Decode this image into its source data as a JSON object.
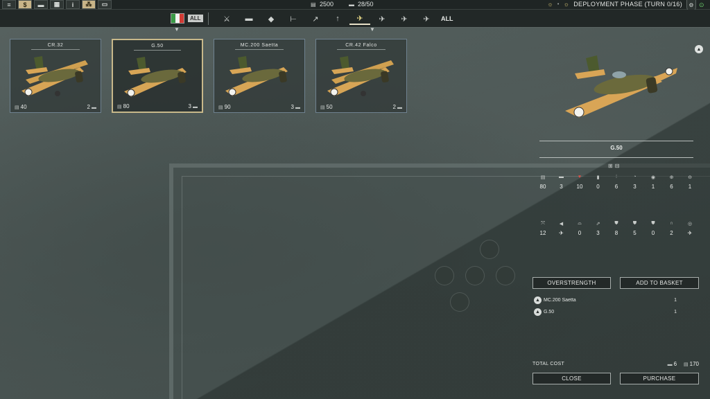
{
  "topbar": {
    "buttons": [
      {
        "icon": "menu-icon",
        "glyph": "≡"
      },
      {
        "icon": "money-icon",
        "glyph": "$"
      },
      {
        "icon": "chat-icon",
        "glyph": "▬"
      },
      {
        "icon": "grid-icon",
        "glyph": "▦"
      },
      {
        "icon": "info-icon",
        "glyph": "i"
      },
      {
        "icon": "unit-icon",
        "glyph": "⁂"
      },
      {
        "icon": "screen-icon",
        "glyph": "▭"
      }
    ],
    "prestige": "2500",
    "unit_slots": "28/50",
    "phase": "DEPLOYMENT PHASE (TURN 0/16)"
  },
  "filterbar": {
    "all_chip": "ALL",
    "categories": [
      {
        "name": "infantry",
        "glyph": "⚔"
      },
      {
        "name": "tank",
        "glyph": "▬"
      },
      {
        "name": "recon",
        "glyph": "◆"
      },
      {
        "name": "anti-tank",
        "glyph": "⊢"
      },
      {
        "name": "artillery",
        "glyph": "↗"
      },
      {
        "name": "anti-air",
        "glyph": "↑"
      },
      {
        "name": "fighter",
        "glyph": "✈"
      },
      {
        "name": "tactical-bomber",
        "glyph": "✈"
      },
      {
        "name": "strategic-bomber",
        "glyph": "✈"
      },
      {
        "name": "transport",
        "glyph": "✈"
      }
    ],
    "selected_category": "fighter",
    "all_label": "ALL",
    "flag_colors": [
      "#3a9a46",
      "#f2f2f2",
      "#d23a34"
    ]
  },
  "units": [
    {
      "name": "CR.32",
      "cost": "40",
      "count": "2",
      "type": "biplane",
      "selected": false
    },
    {
      "name": "G.50",
      "cost": "80",
      "count": "3",
      "type": "mono",
      "selected": true
    },
    {
      "name": "MC.200 Saetta",
      "cost": "90",
      "count": "3",
      "type": "mono",
      "selected": false
    },
    {
      "name": "CR.42 Falco",
      "cost": "50",
      "count": "2",
      "type": "biplane",
      "selected": false
    }
  ],
  "detail": {
    "name": "G.50",
    "stats_row1": [
      {
        "icon": "cost-icon",
        "glyph": "▤",
        "value": "80"
      },
      {
        "icon": "tank-icon",
        "glyph": "▬",
        "value": "3"
      },
      {
        "icon": "heart-icon",
        "glyph": "♥",
        "value": "10"
      },
      {
        "icon": "ammo-icon",
        "glyph": "▮",
        "value": "0"
      },
      {
        "icon": "bullets-icon",
        "glyph": "⦙",
        "value": "6"
      },
      {
        "icon": "initiative-icon",
        "glyph": "◔",
        "value": "3"
      },
      {
        "icon": "soft-attack-icon",
        "glyph": "◉",
        "value": "1"
      },
      {
        "icon": "air-attack-icon",
        "glyph": "⊕",
        "value": "6"
      },
      {
        "icon": "naval-icon",
        "glyph": "⊖",
        "value": "1"
      }
    ],
    "stats_row2": [
      {
        "icon": "movement-icon",
        "glyph": "⤧",
        "value": "12"
      },
      {
        "icon": "spotting-icon",
        "glyph": "◀",
        "value": "✈"
      },
      {
        "icon": "range-icon",
        "glyph": "⌓",
        "value": "0"
      },
      {
        "icon": "rate-icon",
        "glyph": "⇗",
        "value": "3"
      },
      {
        "icon": "ground-def-icon",
        "glyph": "⛊",
        "value": "8"
      },
      {
        "icon": "air-def-icon",
        "glyph": "⛊",
        "value": "5"
      },
      {
        "icon": "close-def-icon",
        "glyph": "⛊",
        "value": "0"
      },
      {
        "icon": "fuel-icon",
        "glyph": "∩",
        "value": "2"
      },
      {
        "icon": "target-type-icon",
        "glyph": "◎",
        "value": "✈"
      }
    ]
  },
  "actions": {
    "overstrength": "OVERSTRENGTH",
    "add_to_basket": "ADD TO BASKET",
    "close": "CLOSE",
    "purchase": "PURCHASE"
  },
  "basket": [
    {
      "name": "MC.200 Saetta",
      "qty": "1"
    },
    {
      "name": "G.50",
      "qty": "1"
    }
  ],
  "total": {
    "label": "TOTAL COST",
    "units": "6",
    "prestige": "170"
  }
}
